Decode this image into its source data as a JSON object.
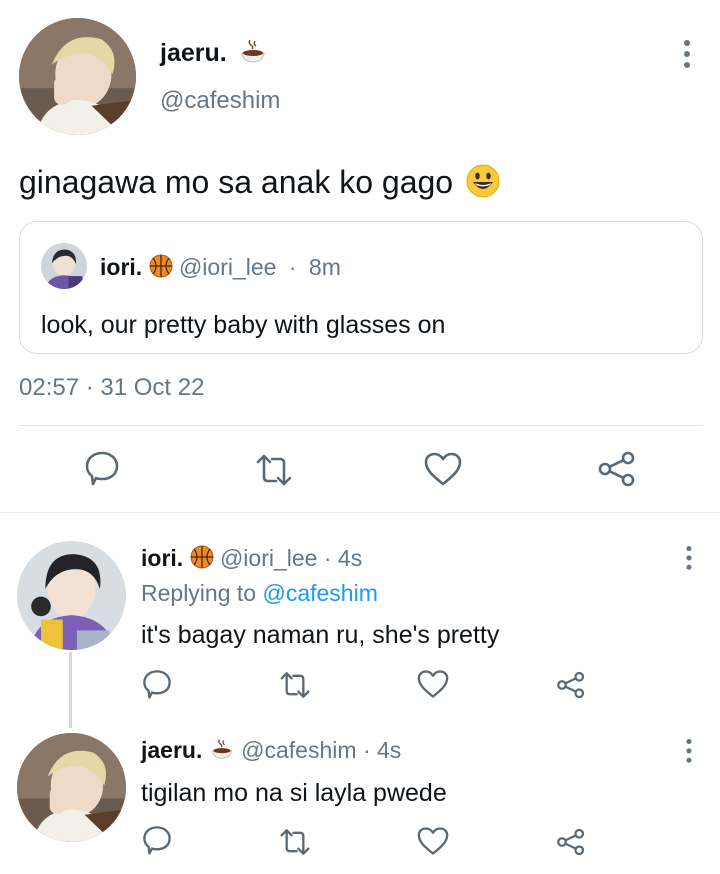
{
  "main_tweet": {
    "display_name": "jaeru.",
    "name_emoji_icon": "coffee-cup-icon",
    "handle": "@cafeshim",
    "text": "ginagawa mo sa anak ko gago",
    "text_emoji_icon": "grinning-face-icon",
    "timestamp": "02:57 · 31 Oct 22",
    "quote": {
      "display_name": "iori.",
      "name_emoji_icon": "basketball-icon",
      "handle": "@iori_lee",
      "separator": "·",
      "time": "8m",
      "text": "look, our pretty baby with glasses on"
    },
    "actions": [
      "reply-icon",
      "retweet-icon",
      "like-icon",
      "share-icon"
    ]
  },
  "replies": [
    {
      "display_name": "iori.",
      "name_emoji_icon": "basketball-icon",
      "handle": "@iori_lee",
      "time": "· 4s",
      "replying_prefix": "Replying to",
      "replying_to": "@cafeshim",
      "text": "it's bagay naman ru, she's pretty"
    },
    {
      "display_name": "jaeru.",
      "name_emoji_icon": "coffee-cup-icon",
      "handle": "@cafeshim",
      "time": "· 4s",
      "text": "tigilan mo na si layla pwede"
    }
  ],
  "colors": {
    "text": "#0f1419",
    "muted": "#657786",
    "link": "#1d9bf0",
    "border": "#d6dde3"
  }
}
